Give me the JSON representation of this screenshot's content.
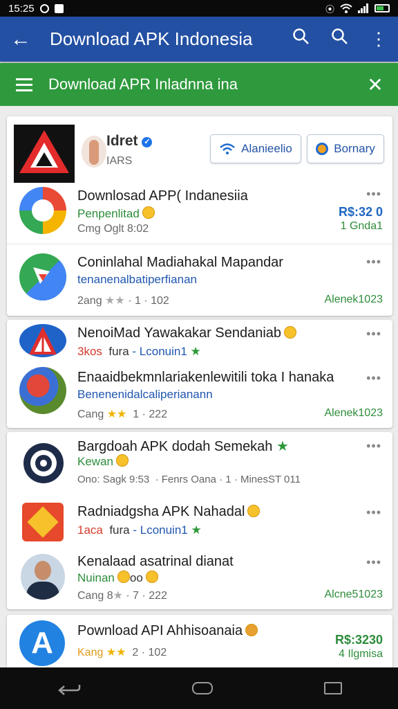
{
  "status_bar": {
    "time": "15:25",
    "icons": [
      "alarm-icon",
      "image-icon",
      "wifi-icon",
      "signal-icon",
      "battery-icon"
    ]
  },
  "app_bar": {
    "title": "Download APK Indonesia",
    "back_icon": "←",
    "search_icon": "⌕",
    "more_icon": "⋮"
  },
  "sub_bar": {
    "title": "Download APR Inladnna ina",
    "close_icon": "✕"
  },
  "header_card": {
    "profile_name": "Idret",
    "profile_sub": "IARS",
    "button1_label": "Alanieelio",
    "button2_label": "Bornary"
  },
  "apps": [
    {
      "title": "Downlosad APP( Indanesiia",
      "subtitle": "Penpenlitad",
      "meta": "Cmg  Oglt    8:02",
      "right_top": "R$:32 0",
      "right_bottom": "1 Gnda1"
    },
    {
      "title": "Coninlahal Madiahakal Mapandar",
      "subtitle": "tenanenalbatiperfianan",
      "meta": "2ang",
      "stars": "★★",
      "meta2": "· 1 · 102",
      "right_bottom": "Alenek1023"
    },
    {
      "title": "NenoiMad Yawakakar Sendaniab",
      "subtitle_a": "3kos",
      "subtitle_b": "fura",
      "subtitle_c": "- Lconuin1",
      "meta": ""
    },
    {
      "title": "Enaaidbekmnlariakenlewitili toka I hanaka",
      "subtitle": "Benenenidalcaliperianann",
      "meta": "Cang",
      "stars": "★★",
      "meta2": "1 · 222",
      "right_bottom": "Alenek1023"
    },
    {
      "title": "Bargdoah APK dodah Semekah",
      "subtitle": "Kewan",
      "meta": "Ono:  Sagk    9:53",
      "meta_mid": "· Fenrs  Oana",
      "meta_end": "· 1 · MinesST 011"
    },
    {
      "title": "Radniadgsha APK Nahadal",
      "subtitle_a": "1aca",
      "subtitle_b": "fura",
      "subtitle_c": "- Lconuin1"
    },
    {
      "title": "Kenalaad asatrinal dianat",
      "subtitle": "Nuinan",
      "subtitle_b": "oo",
      "meta": "Cang  8",
      "stars": "★",
      "meta2": "· 7 · 222",
      "right_bottom": "Alcne51023"
    },
    {
      "title": "Pownload API Ahhisoanaia",
      "subtitle": "Kang",
      "stars": "★★",
      "meta2": "2 · 102",
      "right_top": "R$:3230",
      "right_bottom": "4  Ilgmisa"
    }
  ],
  "more_label": "•••",
  "colors": {
    "app_bar": "#2350a3",
    "sub_bar": "#2e9a3d",
    "price": "#1f66c1",
    "green_text": "#2d8c3a",
    "red_text": "#d23a2a",
    "blue_text": "#2056b0"
  }
}
